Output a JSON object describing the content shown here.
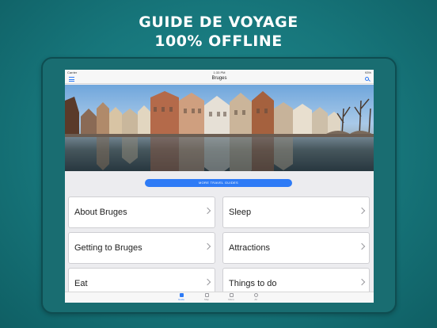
{
  "promo": {
    "line1": "GUIDE DE VOYAGE",
    "line2": "100% OFFLINE"
  },
  "statusbar": {
    "carrier": "Carrier",
    "time": "1:33 PM",
    "battery": "93%"
  },
  "navbar": {
    "title": "Bruges"
  },
  "hero": {
    "page_count": 5,
    "active_page": 0
  },
  "more_button": {
    "label": "MORE TRAVEL GUIDES"
  },
  "menu": [
    {
      "label": "About Bruges"
    },
    {
      "label": "Sleep"
    },
    {
      "label": "Getting to Bruges"
    },
    {
      "label": "Attractions"
    },
    {
      "label": "Eat"
    },
    {
      "label": "Things to do"
    }
  ],
  "tabs": [
    {
      "label": "Guide",
      "icon": "book-icon",
      "active": true
    },
    {
      "label": "Map",
      "icon": "map-icon",
      "active": false
    },
    {
      "label": "Menu",
      "icon": "menu-icon",
      "active": false
    },
    {
      "label": "All",
      "icon": "globe-icon",
      "active": false
    }
  ],
  "colors": {
    "background": "#17767b",
    "accent": "#2e7bf6"
  }
}
